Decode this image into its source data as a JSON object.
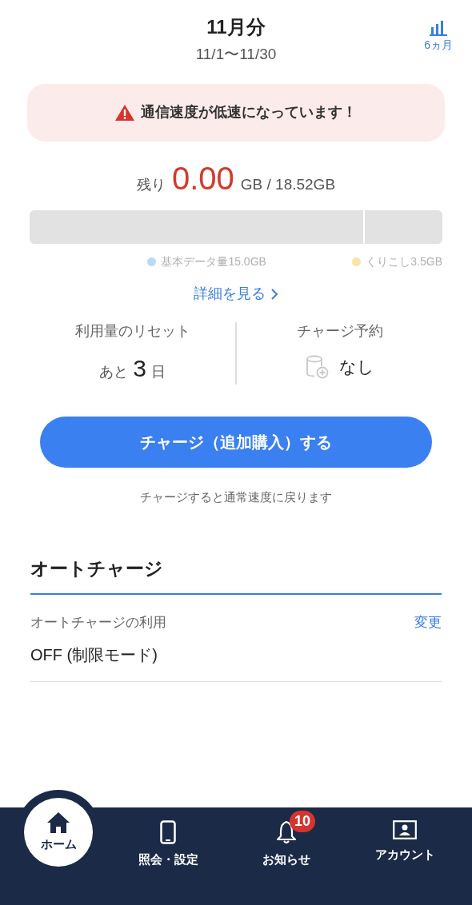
{
  "header": {
    "title": "11月分",
    "period": "11/1〜11/30",
    "history_link": "6ヵ月"
  },
  "alert": {
    "text": "通信速度が低速になっています！"
  },
  "remaining": {
    "prefix": "残り",
    "amount": "0.00",
    "suffix": "GB / 18.52GB"
  },
  "usage_bar": {
    "segments": [
      {
        "label": "基本データ量15.0GB",
        "color": "#b9dcf6"
      },
      {
        "label": "くりこし3.5GB",
        "color": "#f7e5aa"
      }
    ]
  },
  "details_link": "詳細を見る",
  "stats": [
    {
      "label": "利用量のリセット",
      "prefix": "あと",
      "value": "3",
      "suffix": "日"
    },
    {
      "label": "チャージ予約",
      "value": "なし"
    }
  ],
  "charge_button": "チャージ（追加購入）する",
  "charge_note": "チャージすると通常速度に戻ります",
  "auto_charge": {
    "heading": "オートチャージ",
    "label": "オートチャージの利用",
    "change_link": "変更",
    "value": "OFF (制限モード)"
  },
  "nav": [
    {
      "kind": "home",
      "label": "ホーム",
      "selected": true
    },
    {
      "kind": "phone",
      "label": "照会・設定",
      "selected": false
    },
    {
      "kind": "bell",
      "label": "お知らせ",
      "selected": false,
      "badge": "10"
    },
    {
      "kind": "account",
      "label": "アカウント",
      "selected": false
    }
  ]
}
